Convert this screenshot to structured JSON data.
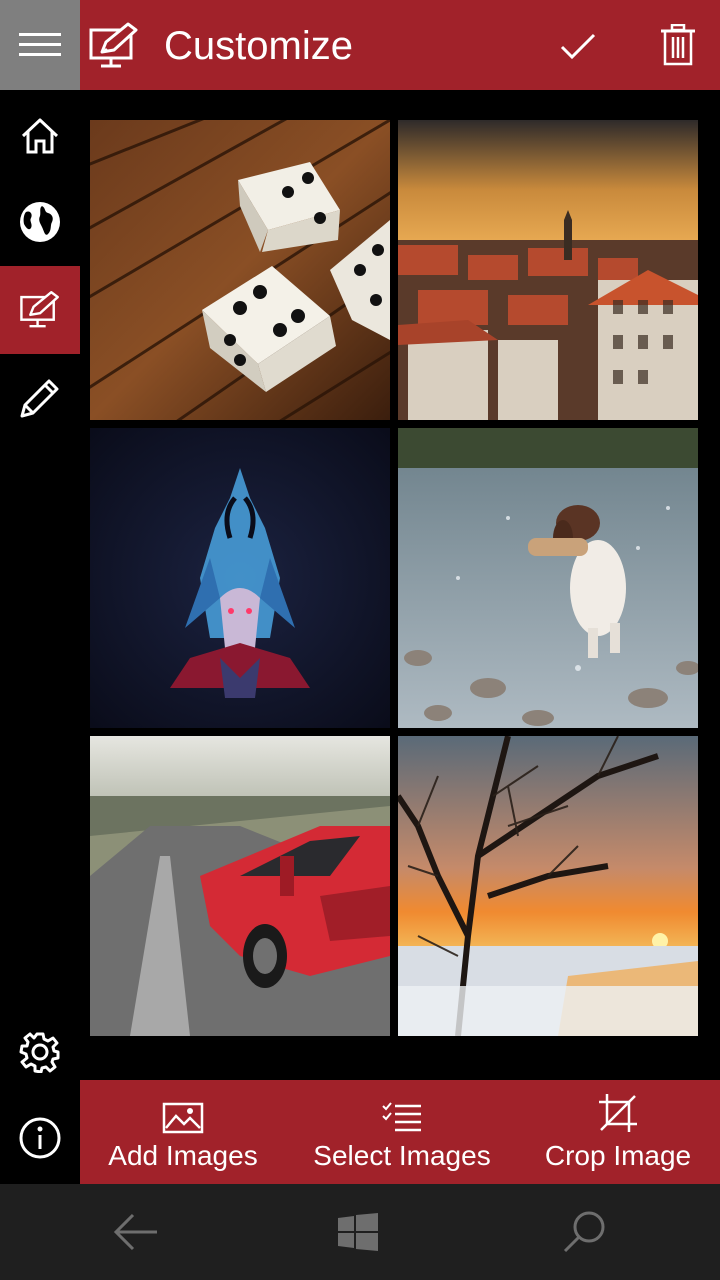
{
  "app": {
    "title": "Customize"
  },
  "header": {
    "menu_icon": "hamburger-icon",
    "title_icon": "customize-screen-icon",
    "accept_icon": "checkmark-icon",
    "delete_icon": "trash-icon"
  },
  "sidebar": {
    "items": [
      {
        "name": "home",
        "icon": "home-icon",
        "active": false
      },
      {
        "name": "web",
        "icon": "globe-icon",
        "active": false
      },
      {
        "name": "customize",
        "icon": "customize-screen-icon",
        "active": true
      },
      {
        "name": "edit",
        "icon": "pencil-icon",
        "active": false
      },
      {
        "name": "settings",
        "icon": "gear-icon",
        "active": false
      },
      {
        "name": "info",
        "icon": "info-icon",
        "active": false
      }
    ]
  },
  "gallery": {
    "images": [
      {
        "subject": "dice on wooden floor"
      },
      {
        "subject": "city rooftops at sunset"
      },
      {
        "subject": "dark fantasy character"
      },
      {
        "subject": "dog running through water"
      },
      {
        "subject": "red sports car on road"
      },
      {
        "subject": "bare tree at winter sunset"
      }
    ]
  },
  "commands": {
    "add": {
      "label": "Add Images",
      "icon": "image-icon"
    },
    "select": {
      "label": "Select Images",
      "icon": "checklist-icon"
    },
    "crop": {
      "label": "Crop Image",
      "icon": "crop-icon"
    }
  },
  "system_bar": {
    "back_icon": "back-arrow-icon",
    "start_icon": "windows-logo-icon",
    "search_icon": "search-icon"
  },
  "colors": {
    "accent": "#a1222a",
    "hamburger_bg": "#7f7f7f",
    "background": "#000000",
    "system_bar": "#1f1f1f"
  }
}
